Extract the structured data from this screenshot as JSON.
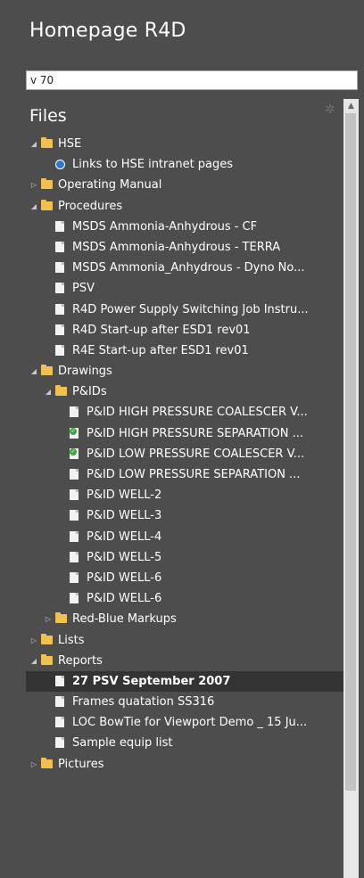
{
  "app": {
    "title": "Homepage R4D"
  },
  "search": {
    "value": "v 70"
  },
  "files": {
    "heading": "Files"
  },
  "tree": [
    {
      "label": "HSE",
      "type": "folder",
      "level": 0,
      "expander": "open"
    },
    {
      "label": "Links to HSE intranet pages",
      "type": "link",
      "level": 1,
      "expander": ""
    },
    {
      "label": "Operating Manual",
      "type": "folder",
      "level": 0,
      "expander": "closed"
    },
    {
      "label": "Procedures",
      "type": "folder",
      "level": 0,
      "expander": "open"
    },
    {
      "label": "MSDS Ammonia-Anhydrous - CF",
      "type": "doc",
      "level": 1,
      "expander": ""
    },
    {
      "label": "MSDS Ammonia-Anhydrous - TERRA",
      "type": "doc",
      "level": 1,
      "expander": ""
    },
    {
      "label": "MSDS Ammonia_Anhydrous - Dyno No...",
      "type": "doc",
      "level": 1,
      "expander": ""
    },
    {
      "label": "PSV",
      "type": "doc",
      "level": 1,
      "expander": ""
    },
    {
      "label": "R4D Power Supply Switching Job Instru...",
      "type": "doc",
      "level": 1,
      "expander": ""
    },
    {
      "label": "R4D Start-up after ESD1 rev01",
      "type": "doc",
      "level": 1,
      "expander": ""
    },
    {
      "label": "R4E Start-up after ESD1 rev01",
      "type": "doc",
      "level": 1,
      "expander": ""
    },
    {
      "label": "Drawings",
      "type": "folder",
      "level": 0,
      "expander": "open"
    },
    {
      "label": "P&IDs",
      "type": "folder",
      "level": 1,
      "expander": "open"
    },
    {
      "label": "P&ID HIGH PRESSURE COALESCER V...",
      "type": "doc",
      "level": 2,
      "expander": ""
    },
    {
      "label": "P&ID HIGH PRESSURE SEPARATION ...",
      "type": "checked",
      "level": 2,
      "expander": ""
    },
    {
      "label": "P&ID LOW PRESSURE COALESCER V...",
      "type": "checked",
      "level": 2,
      "expander": ""
    },
    {
      "label": "P&ID LOW PRESSURE SEPARATION ...",
      "type": "doc",
      "level": 2,
      "expander": ""
    },
    {
      "label": "P&ID WELL-2",
      "type": "doc",
      "level": 2,
      "expander": ""
    },
    {
      "label": "P&ID WELL-3",
      "type": "doc",
      "level": 2,
      "expander": ""
    },
    {
      "label": "P&ID WELL-4",
      "type": "doc",
      "level": 2,
      "expander": ""
    },
    {
      "label": "P&ID WELL-5",
      "type": "doc",
      "level": 2,
      "expander": ""
    },
    {
      "label": "P&ID WELL-6",
      "type": "doc",
      "level": 2,
      "expander": ""
    },
    {
      "label": "P&ID WELL-6",
      "type": "doc",
      "level": 2,
      "expander": ""
    },
    {
      "label": "Red-Blue Markups",
      "type": "folder",
      "level": 1,
      "expander": "closed"
    },
    {
      "label": "Lists",
      "type": "folder",
      "level": 0,
      "expander": "closed"
    },
    {
      "label": "Reports",
      "type": "folder",
      "level": 0,
      "expander": "open"
    },
    {
      "label": "27 PSV September 2007",
      "type": "doc",
      "level": 1,
      "expander": "",
      "selected": true
    },
    {
      "label": "Frames quatation SS316",
      "type": "doc",
      "level": 1,
      "expander": ""
    },
    {
      "label": "LOC BowTie for Viewport Demo _ 15 Ju...",
      "type": "doc",
      "level": 1,
      "expander": ""
    },
    {
      "label": "Sample equip list",
      "type": "doc",
      "level": 1,
      "expander": ""
    },
    {
      "label": "Pictures",
      "type": "folder",
      "level": 0,
      "expander": "closed"
    }
  ],
  "icons": {
    "gear": "gear-icon",
    "scroll_up": "scroll-up-arrow-icon",
    "folder": "folder-icon",
    "document": "document-icon",
    "link": "link-icon",
    "checked_document": "checked-document-icon"
  },
  "colors": {
    "panel_background": "#4d4d4d",
    "selected_row": "#333333",
    "folder": "#f0c050",
    "scrollbar_track": "#e6e6e6",
    "scrollbar_thumb": "#c2c2c2"
  }
}
